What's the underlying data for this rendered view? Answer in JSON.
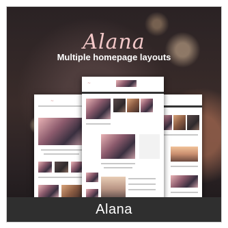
{
  "banner": {
    "logo_text": "Alana",
    "tagline": "Multiple homepage layouts",
    "caption": "Alana"
  },
  "colors": {
    "accent": "#f3c8c8",
    "caption_bar": "#2f2f2f"
  }
}
